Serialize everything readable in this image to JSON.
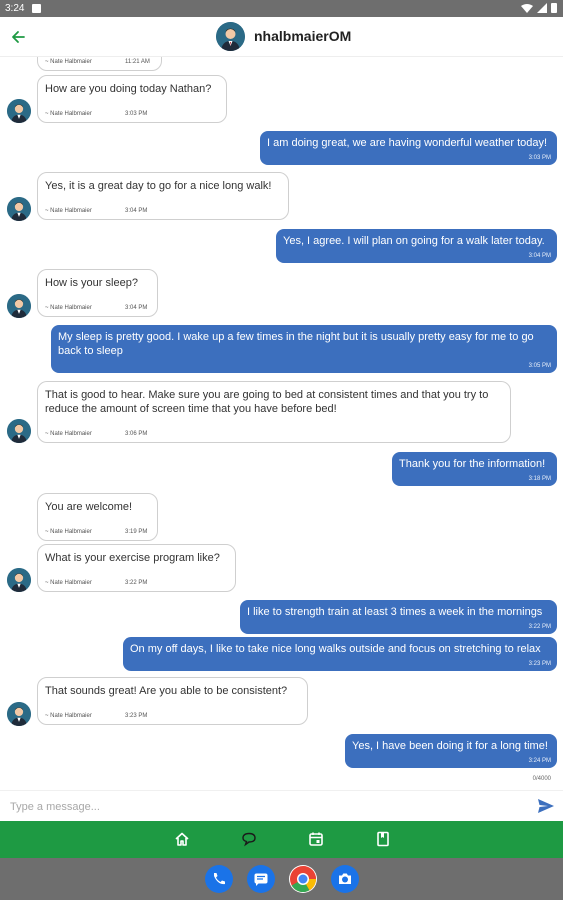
{
  "status_bar": {
    "time": "3:24"
  },
  "header": {
    "title": "nhalbmaierOM",
    "back_icon": "arrow-back-icon",
    "accent_color": "#1e9a43"
  },
  "messages": [
    {
      "dir": "in",
      "text": "",
      "author": "~ Nate Halbmaier",
      "time": "11:21 AM"
    },
    {
      "dir": "in",
      "text": "How are you doing today Nathan?",
      "author": "~ Nate Halbmaier",
      "time": "3:03 PM"
    },
    {
      "dir": "out",
      "text": "I am doing great, we are having wonderful weather today!",
      "time": "3:03 PM"
    },
    {
      "dir": "in",
      "text": "Yes, it is a great day to go for a nice long walk!",
      "author": "~ Nate Halbmaier",
      "time": "3:04 PM"
    },
    {
      "dir": "out",
      "text": "Yes, I agree.  I will plan on going for a walk later today.",
      "time": "3:04 PM"
    },
    {
      "dir": "in",
      "text": "How is your sleep?",
      "author": "~ Nate Halbmaier",
      "time": "3:04 PM"
    },
    {
      "dir": "out",
      "text": "My sleep is pretty good.  I wake up a few times in the night but it is usually pretty easy for me to go back to sleep",
      "time": "3:05 PM"
    },
    {
      "dir": "in",
      "text": "That is good to hear.  Make sure you are going to bed at consistent times and that you try to reduce the amount of screen time that you have before bed!",
      "author": "~ Nate Halbmaier",
      "time": "3:06 PM"
    },
    {
      "dir": "out",
      "text": "Thank you for the information!",
      "time": "3:18 PM"
    },
    {
      "dir": "in",
      "text": "You are welcome!",
      "author": "~ Nate Halbmaier",
      "time": "3:19 PM"
    },
    {
      "dir": "in",
      "text": "What is your exercise program like?",
      "author": "~ Nate Halbmaier",
      "time": "3:22 PM"
    },
    {
      "dir": "out",
      "text": "I like to strength train at least 3 times a week in the mornings",
      "time": "3:22 PM"
    },
    {
      "dir": "out",
      "text": "On my off days, I like to take nice long walks outside and focus on stretching to relax",
      "time": "3:23 PM"
    },
    {
      "dir": "in",
      "text": "That sounds great!  Are you able to be consistent?",
      "author": "~ Nate Halbmaier",
      "time": "3:23 PM"
    },
    {
      "dir": "out",
      "text": "Yes, I have been doing it for a long time!",
      "time": "3:24 PM"
    }
  ],
  "char_counter": "0/4000",
  "composer": {
    "placeholder": "Type a message..."
  },
  "bottom_nav": [
    {
      "icon": "home-icon"
    },
    {
      "icon": "chat-icon"
    },
    {
      "icon": "calendar-icon"
    },
    {
      "icon": "bookmark-icon"
    }
  ],
  "dock": [
    {
      "icon": "phone-app-icon",
      "color": "#1a73e8"
    },
    {
      "icon": "messages-app-icon",
      "color": "#1a73e8"
    },
    {
      "icon": "chrome-app-icon",
      "color": "#ea4335"
    },
    {
      "icon": "camera-app-icon",
      "color": "#1a73e8"
    }
  ]
}
